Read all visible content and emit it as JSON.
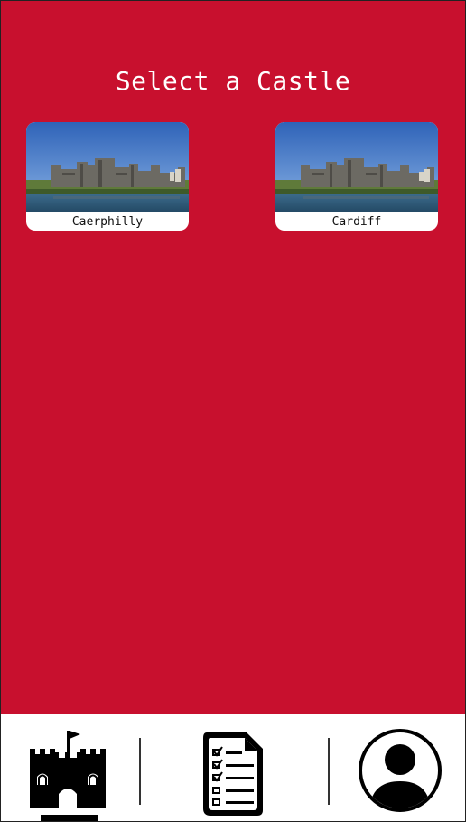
{
  "page": {
    "title": "Select a Castle"
  },
  "castles": [
    {
      "name": "Caerphilly",
      "image": "castle-photo"
    },
    {
      "name": "Cardiff",
      "image": "castle-photo"
    }
  ],
  "nav": {
    "items": [
      {
        "icon": "castle-icon",
        "active": true
      },
      {
        "icon": "checklist-icon",
        "active": false
      },
      {
        "icon": "profile-icon",
        "active": false
      }
    ]
  },
  "colors": {
    "accent": "#c8102e",
    "background": "#ffffff",
    "icon": "#000000"
  }
}
